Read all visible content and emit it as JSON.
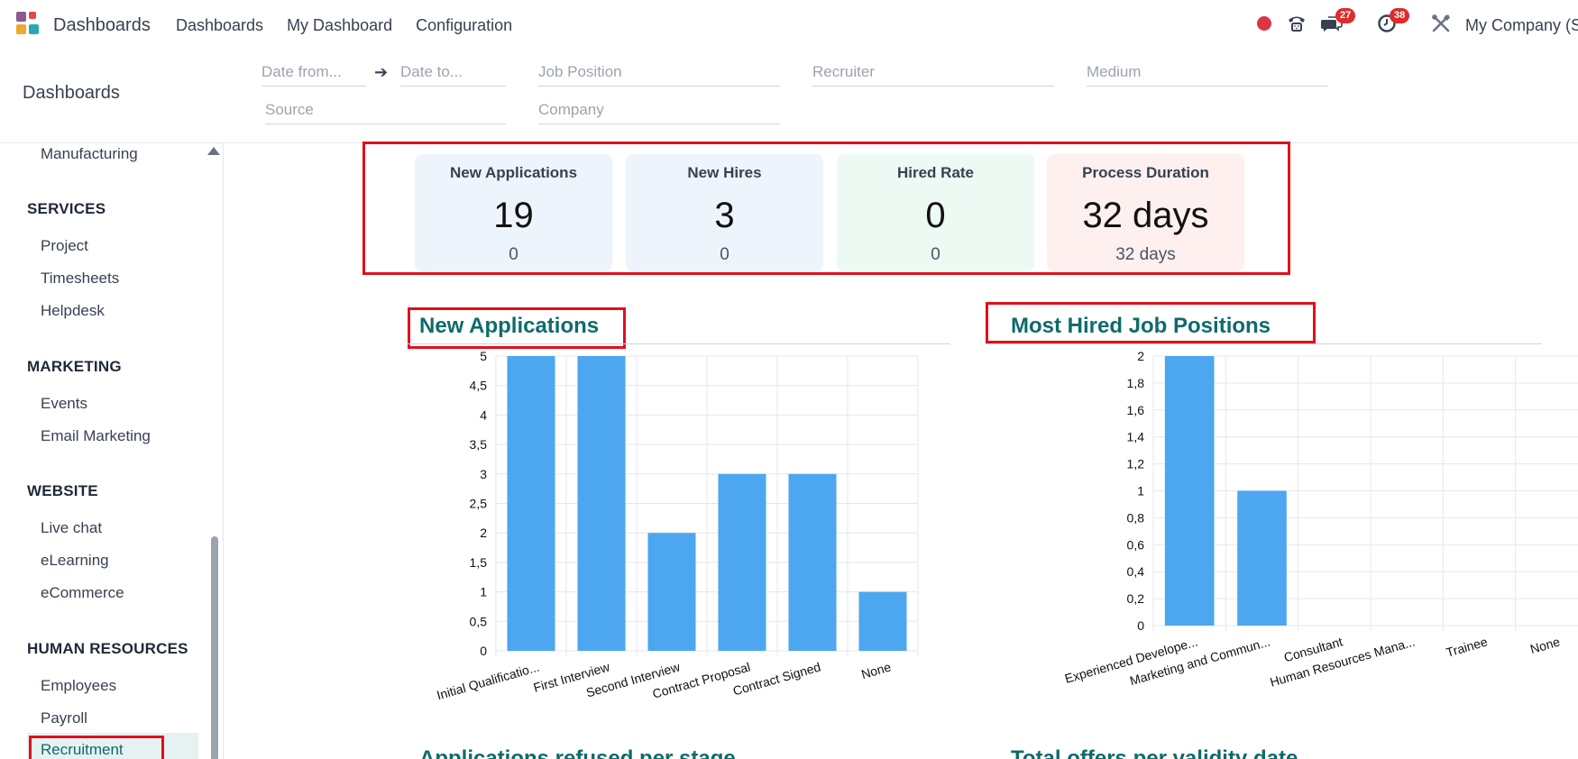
{
  "navbar": {
    "app_name": "Dashboards",
    "menu": [
      "Dashboards",
      "My Dashboard",
      "Configuration"
    ],
    "messages_count": "27",
    "activities_count": "38",
    "company": "My Company (Sa"
  },
  "control_panel": {
    "title": "Dashboards",
    "filters": {
      "date_from": "Date from...",
      "date_to": "Date to...",
      "job_position": "Job Position",
      "recruiter": "Recruiter",
      "medium": "Medium",
      "source": "Source",
      "company": "Company"
    }
  },
  "sidebar": {
    "top_item": "Manufacturing",
    "sections": [
      {
        "heading": "SERVICES",
        "items": [
          "Project",
          "Timesheets",
          "Helpdesk"
        ]
      },
      {
        "heading": "MARKETING",
        "items": [
          "Events",
          "Email Marketing"
        ]
      },
      {
        "heading": "WEBSITE",
        "items": [
          "Live chat",
          "eLearning",
          "eCommerce"
        ]
      },
      {
        "heading": "HUMAN RESOURCES",
        "items": [
          "Employees",
          "Payroll",
          "Recruitment"
        ]
      }
    ],
    "active_item": "Recruitment"
  },
  "kpis": [
    {
      "title": "New Applications",
      "value": "19",
      "sub": "0",
      "color": "#eef4fb"
    },
    {
      "title": "New Hires",
      "value": "3",
      "sub": "0",
      "color": "#eef4fb"
    },
    {
      "title": "Hired Rate",
      "value": "0",
      "sub": "0",
      "color": "#edfaf3"
    },
    {
      "title": "Process Duration",
      "value": "32 days",
      "sub": "32 days",
      "color": "#fdf0ef"
    }
  ],
  "chart_data": [
    {
      "type": "bar",
      "title": "New Applications",
      "categories": [
        "Initial Qualificatio...",
        "First Interview",
        "Second Interview",
        "Contract Proposal",
        "Contract Signed",
        "None"
      ],
      "values": [
        5,
        5,
        2,
        3,
        3,
        1
      ],
      "ylim": [
        0,
        5
      ],
      "yticks": [
        "0",
        "0,5",
        "1",
        "1,5",
        "2",
        "2,5",
        "3",
        "3,5",
        "4",
        "4,5",
        "5"
      ],
      "bar_color": "#4da6f0"
    },
    {
      "type": "bar",
      "title": "Most Hired Job Positions",
      "categories": [
        "Experienced Develope...",
        "Marketing and Commun...",
        "Consultant",
        "Human Resources Mana...",
        "Trainee",
        "None"
      ],
      "values": [
        2,
        1,
        0,
        0,
        0,
        0
      ],
      "ylim": [
        0,
        2
      ],
      "yticks": [
        "0",
        "0,2",
        "0,4",
        "0,6",
        "0,8",
        "1",
        "1,2",
        "1,4",
        "1,6",
        "1,8",
        "2"
      ],
      "bar_color": "#4da6f0"
    }
  ],
  "lower_titles": [
    "Applications refused per stage",
    "Total offers per validity date"
  ],
  "colors": {
    "accent": "#0e6b6b",
    "highlight": "#e0101c",
    "badge": "#e02b2b"
  }
}
